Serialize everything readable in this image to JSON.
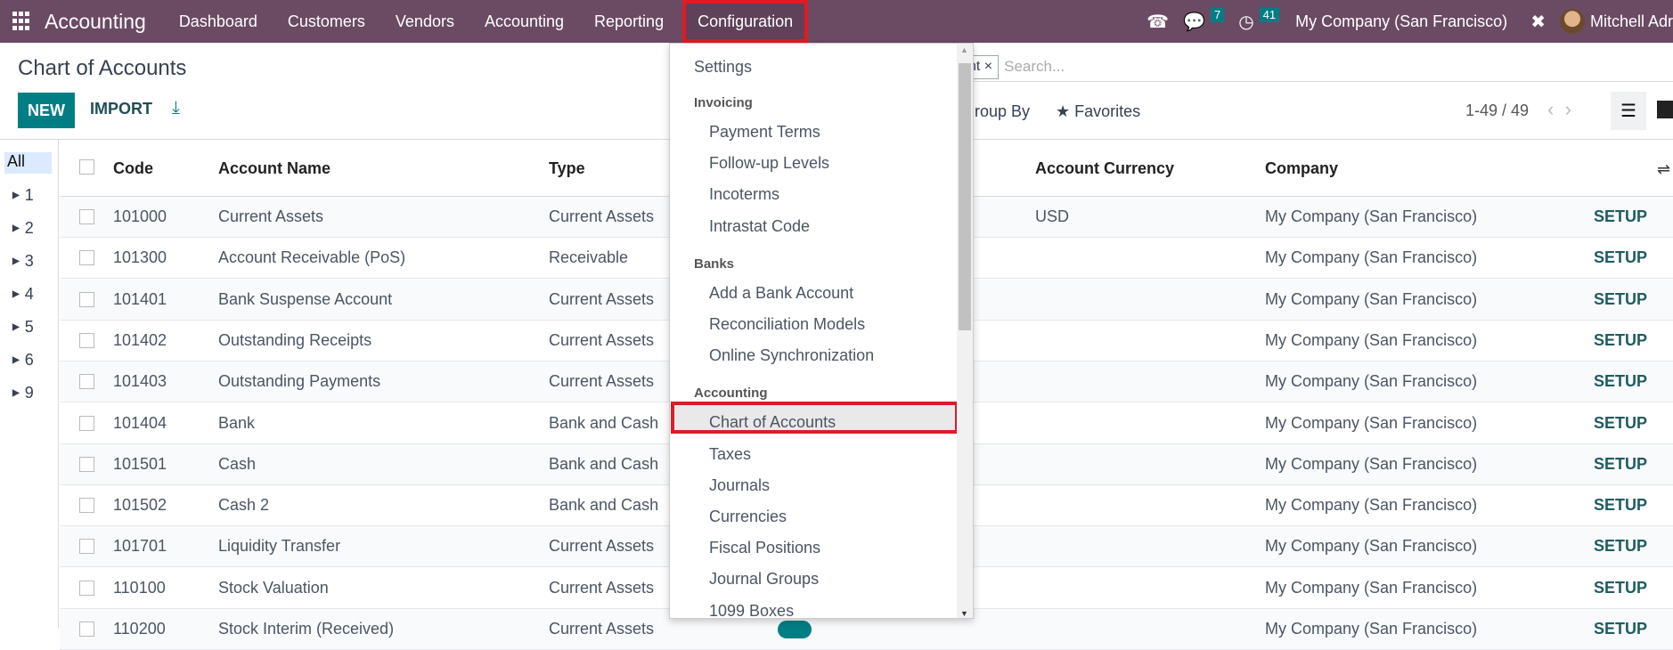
{
  "nav": {
    "brand": "Accounting",
    "menu": [
      "Dashboard",
      "Customers",
      "Vendors",
      "Accounting",
      "Reporting",
      "Configuration"
    ],
    "messages_count": "7",
    "activities_count": "41",
    "company": "My Company (San Francisco)",
    "user": "Mitchell Adr"
  },
  "page": {
    "title": "Chart of Accounts",
    "new_label": "NEW",
    "import_label": "IMPORT"
  },
  "search": {
    "facet": "nt",
    "placeholder": "Search..."
  },
  "filters": {
    "group_by": "Group By",
    "favorites": "Favorites"
  },
  "pager": "1-49 / 49",
  "sidebar": {
    "all": "All",
    "groups": [
      "1",
      "2",
      "3",
      "4",
      "5",
      "6",
      "9"
    ]
  },
  "table": {
    "columns": [
      "Code",
      "Account Name",
      "Type",
      "Account Currency",
      "Company"
    ],
    "rows": [
      [
        "101000",
        "Current Assets",
        "Current Assets",
        "USD",
        "My Company (San Francisco)"
      ],
      [
        "101300",
        "Account Receivable (PoS)",
        "Receivable",
        "",
        "My Company (San Francisco)"
      ],
      [
        "101401",
        "Bank Suspense Account",
        "Current Assets",
        "",
        "My Company (San Francisco)"
      ],
      [
        "101402",
        "Outstanding Receipts",
        "Current Assets",
        "",
        "My Company (San Francisco)"
      ],
      [
        "101403",
        "Outstanding Payments",
        "Current Assets",
        "",
        "My Company (San Francisco)"
      ],
      [
        "101404",
        "Bank",
        "Bank and Cash",
        "",
        "My Company (San Francisco)"
      ],
      [
        "101501",
        "Cash",
        "Bank and Cash",
        "",
        "My Company (San Francisco)"
      ],
      [
        "101502",
        "Cash 2",
        "Bank and Cash",
        "",
        "My Company (San Francisco)"
      ],
      [
        "101701",
        "Liquidity Transfer",
        "Current Assets",
        "",
        "My Company (San Francisco)"
      ],
      [
        "110100",
        "Stock Valuation",
        "Current Assets",
        "",
        "My Company (San Francisco)"
      ],
      [
        "110200",
        "Stock Interim (Received)",
        "Current Assets",
        "",
        "My Company (San Francisco)"
      ]
    ],
    "setup_label": "SETUP"
  },
  "dropdown": {
    "settings": "Settings",
    "sections": [
      {
        "title": "Invoicing",
        "items": [
          "Payment Terms",
          "Follow-up Levels",
          "Incoterms",
          "Intrastat Code"
        ]
      },
      {
        "title": "Banks",
        "items": [
          "Add a Bank Account",
          "Reconciliation Models",
          "Online Synchronization"
        ]
      },
      {
        "title": "Accounting",
        "items": [
          "Chart of Accounts",
          "Taxes",
          "Journals",
          "Currencies",
          "Fiscal Positions",
          "Journal Groups",
          "1099 Boxes"
        ]
      }
    ],
    "highlighted": "Chart of Accounts"
  },
  "colors": {
    "navbar": "#6b4a64",
    "accent": "#017e84",
    "highlight_box": "#e01b24"
  }
}
